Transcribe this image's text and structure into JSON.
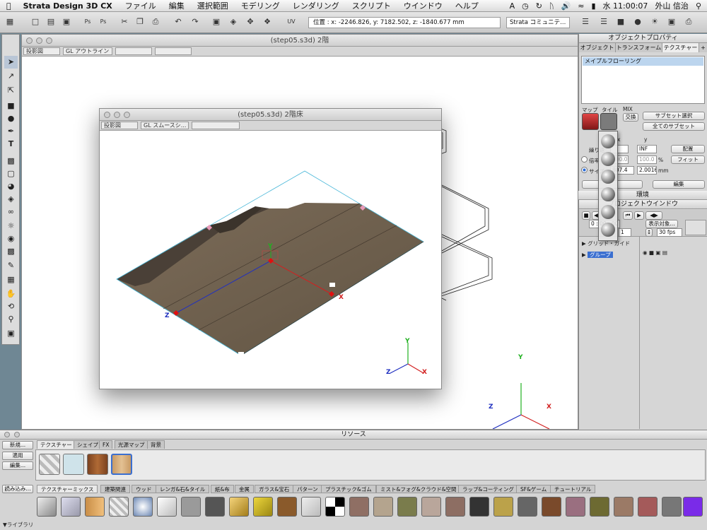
{
  "menubar": {
    "app_name": "Strata Design 3D CX",
    "items": [
      "ファイル",
      "編集",
      "選択範囲",
      "モデリング",
      "レンダリング",
      "スクリプト",
      "ウインドウ",
      "ヘルプ"
    ],
    "clock": "水 11:00:07",
    "user": "外山 信治"
  },
  "toolbar": {
    "coordinates": "位置 : x: -2246.826, y: 7182.502, z: -1840.677 mm",
    "community": "Strata コミュニテ..."
  },
  "main_window": {
    "title": "(step05.s3d) 2階",
    "projection": "投影図",
    "render_mode": "GL アウトライン"
  },
  "inner_window": {
    "title": "(step05.s3d) 2階床",
    "projection": "投影図",
    "render_mode": "GL スムースシ..."
  },
  "axis_labels": {
    "x": "X",
    "y": "Y",
    "z": "Z"
  },
  "object_properties": {
    "title": "オブジェクトプロパティ",
    "tabs": [
      "オブジェクト",
      "トランスフォーム",
      "テクスチャー"
    ],
    "active_tab": "テクスチャー",
    "textures": [
      "メイプルフローリング"
    ],
    "labels": {
      "map": "マップ",
      "tile": "タイル",
      "mix": "MIX",
      "repeat": "繰り返",
      "x": "x",
      "y": "y",
      "unit": "mm",
      "percent": "%",
      "ratio": "倍率",
      "size": "サイズ"
    },
    "buttons": {
      "swap": "交換",
      "subset_select": "サブセット選択",
      "all_subsets": "全てのサブセット",
      "place": "配置",
      "fit": "フィット",
      "edit": "編集"
    },
    "fields": {
      "rep_y": "INF",
      "pct_x": "100.0",
      "pct_y": "100.0",
      "size_x": "807.4",
      "size_y": "2.0016"
    }
  },
  "environment": {
    "title": "環境"
  },
  "project_window": {
    "title": "プロジェクトウインドウ",
    "show_objects": "表示対象...",
    "time": "0 : 00 : 00",
    "frame_label": "1",
    "fps": "30 fps",
    "items": [
      "グリッド・ガイド",
      "グループ"
    ]
  },
  "resources": {
    "title": "リソース",
    "tabs": [
      "テクスチャー",
      "シェイプ",
      "FX",
      "光源マップ",
      "背景"
    ],
    "active_tab": "テクスチャー",
    "buttons": {
      "new": "新規...",
      "apply": "適用",
      "edit": "編集...",
      "load": "読み込み..."
    },
    "library_tabs": [
      "テクスチャーミックス",
      "建築関連",
      "ウッド",
      "レンガ&石&タイル",
      "紙&布",
      "金属",
      "ガラス&宝石",
      "パターン",
      "プラスチック&ゴム",
      "ミスト&フォグ&クラウド&空間",
      "ラップ&コーティング",
      "SF&ゲーム",
      "チュートリアル"
    ],
    "library_label": "ライブラリ"
  },
  "colors": {
    "selection": "#bcd5ee",
    "wood": "#6e5f4d",
    "axis_x": "#d22020",
    "axis_y": "#20b020",
    "axis_z": "#2030c0"
  }
}
